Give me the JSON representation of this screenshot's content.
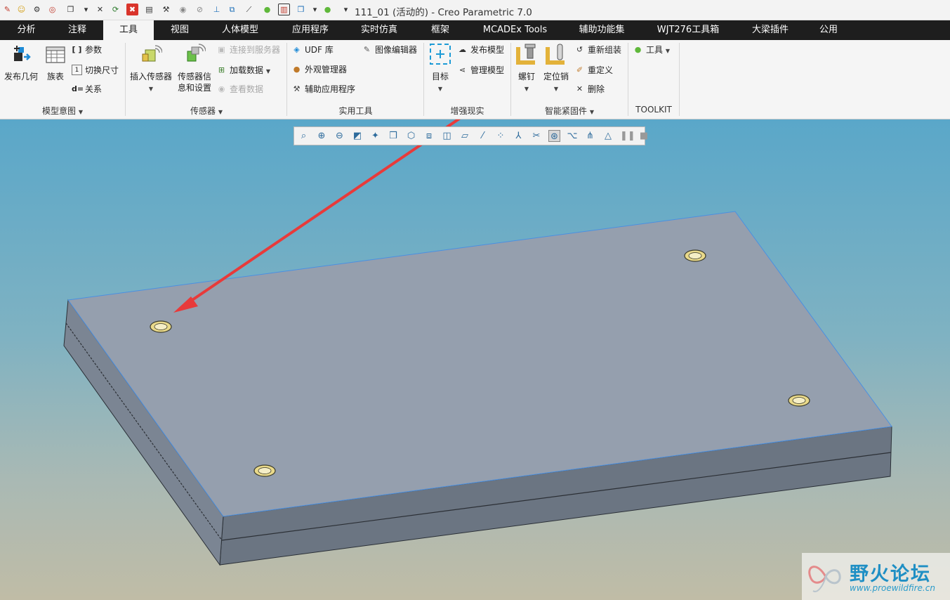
{
  "window": {
    "title": "111_01 (活动的) - Creo Parametric 7.0"
  },
  "quick_access": {
    "icons": [
      "pencil-icon",
      "smiley-icon",
      "gears-icon",
      "target-icon",
      "window-arrange-icon",
      "dropdown-icon",
      "close-windows-icon",
      "regenerate-icon",
      "error-close-icon",
      "parameters-icon",
      "hammer-icon",
      "eye-icon",
      "eye-slash-icon",
      "datum-icon",
      "copy-datum-icon",
      "measure-icon",
      "green-light-icon",
      "color-palette-icon",
      "cube-icon",
      "dropdown-icon",
      "green-light-icon",
      "customize-dropdown-icon"
    ]
  },
  "tabs": [
    {
      "label": "分析"
    },
    {
      "label": "注释"
    },
    {
      "label": "工具",
      "active": true
    },
    {
      "label": "视图"
    },
    {
      "label": "人体模型"
    },
    {
      "label": "应用程序"
    },
    {
      "label": "实时仿真"
    },
    {
      "label": "框架"
    },
    {
      "label": "MCADEx Tools"
    },
    {
      "label": "辅助功能集"
    },
    {
      "label": "WJT276工具箱"
    },
    {
      "label": "大梁插件"
    },
    {
      "label": "公用"
    }
  ],
  "ribbon": {
    "model_intent": {
      "group_label": "模型意图",
      "publish_geometry": "发布几何",
      "family_table": "族表",
      "parameters": "参数",
      "switch_dimensions": "切换尺寸",
      "relations": "关系"
    },
    "sensors": {
      "group_label": "传感器",
      "insert_sensor": "插入传感器",
      "sensor_info_line1": "传感器信",
      "sensor_info_line2": "息和设置",
      "connect_server": "连接到服务器",
      "load_data": "加载数据",
      "view_data": "查看数据"
    },
    "utilities": {
      "group_label": "实用工具",
      "udf_library": "UDF 库",
      "image_editor": "图像编辑器",
      "appearance_manager": "外观管理器",
      "auxiliary_apps": "辅助应用程序"
    },
    "ar": {
      "group_label": "增强现实",
      "target": "目标",
      "publish_model": "发布模型",
      "manage_model": "管理模型"
    },
    "fasteners": {
      "group_label": "智能紧固件",
      "screw": "螺钉",
      "dowel": "定位销",
      "reassemble": "重新组装",
      "redefine": "重定义",
      "delete": "删除"
    },
    "toolkit": {
      "group_label": "TOOLKIT",
      "tools": "工具"
    }
  },
  "view_toolbar": {
    "icons": [
      "refit-icon",
      "zoom-in-icon",
      "zoom-out-icon",
      "repaint-icon",
      "display-style-icon",
      "saved-orientations-icon",
      "named-views-icon",
      "perspective-icon",
      "section-icon",
      "plane-display-icon",
      "axis-display-icon",
      "point-display-icon",
      "csys-display-icon",
      "annotation-display-icon",
      "spin-center-icon",
      "tree-icon",
      "connections-icon",
      "simulation-icon",
      "pause-icon",
      "stop-icon"
    ]
  },
  "colors": {
    "tab_bar": "#1e1e1e",
    "ribbon_bg": "#f5f5f5",
    "part_top": "#959fae",
    "part_side": "#6b7582",
    "edge_highlight": "#4a90e2",
    "annotation_arrow": "#e83a3a"
  },
  "watermark": {
    "title": "野火论坛",
    "url": "www.proewildfire.cn"
  }
}
